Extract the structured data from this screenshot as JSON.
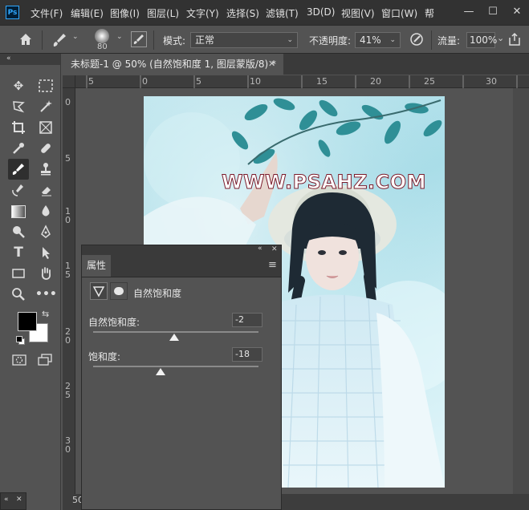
{
  "app": {
    "logo": "Ps"
  },
  "menu": [
    "文件(F)",
    "编辑(E)",
    "图像(I)",
    "图层(L)",
    "文字(Y)",
    "选择(S)",
    "滤镜(T)",
    "3D(D)",
    "视图(V)",
    "窗口(W)",
    "帮"
  ],
  "window_controls": {
    "minimize": "—",
    "maximize": "☐",
    "close": "✕"
  },
  "options": {
    "brush_size": "80",
    "mode_label": "模式:",
    "mode_value": "正常",
    "opacity_label": "不透明度:",
    "opacity_value": "41%",
    "flow_label": "流量:",
    "flow_value": "100%"
  },
  "toolbar": {
    "collapse": "«"
  },
  "document": {
    "tab_title": "未标题-1 @ 50% (自然饱和度 1, 图层蒙版/8) *",
    "close": "✕",
    "zoom": "50"
  },
  "rulers": {
    "h": [
      "5",
      "0",
      "5",
      "10",
      "15",
      "20",
      "25",
      "30"
    ],
    "v": [
      "0",
      "5",
      "1\n0",
      "1\n5",
      "2\n0",
      "2\n5",
      "3\n0"
    ]
  },
  "canvas": {
    "watermark": "WWW.PSAHZ.COM"
  },
  "properties": {
    "collapse": "«",
    "close": "✕",
    "tab": "属性",
    "menu": "≡",
    "adjustment_title": "自然饱和度",
    "vibrance_label": "自然饱和度:",
    "vibrance_value": "-2",
    "vibrance_level": -2,
    "saturation_label": "饱和度:",
    "saturation_value": "-18",
    "saturation_level": -18
  },
  "mini_panel": {
    "collapse": "«",
    "close": "✕"
  },
  "colors": {
    "foreground": "#000000",
    "background": "#ffffff",
    "accent": "#31a8ff"
  }
}
